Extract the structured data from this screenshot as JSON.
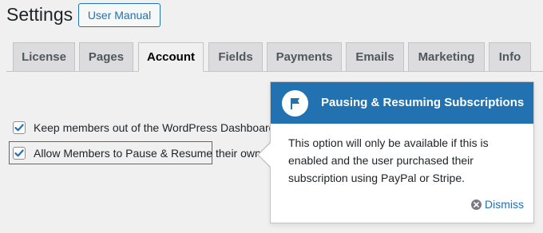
{
  "header": {
    "title": "Settings",
    "manual_button": "User Manual"
  },
  "tabs": [
    {
      "label": "License",
      "active": false
    },
    {
      "label": "Pages",
      "active": false
    },
    {
      "label": "Account",
      "active": true
    },
    {
      "label": "Fields",
      "active": false
    },
    {
      "label": "Payments",
      "active": false
    },
    {
      "label": "Emails",
      "active": false
    },
    {
      "label": "Marketing",
      "active": false
    },
    {
      "label": "Info",
      "active": false
    }
  ],
  "options": [
    {
      "label": "Keep members out of the WordPress Dashboard",
      "checked": true
    },
    {
      "label": "Allow Members to Pause & Resume their own",
      "checked": true
    }
  ],
  "pointer": {
    "title": "Pausing & Resuming Subscriptions",
    "icon": "flag-icon",
    "body": "This option will only be available if this is enabled and the user purchased their subscription using PayPal or Stripe.",
    "dismiss_label": "Dismiss"
  },
  "colors": {
    "accent": "#2271b1",
    "highlight_border": "#d63638",
    "background": "#f0f0f1"
  }
}
